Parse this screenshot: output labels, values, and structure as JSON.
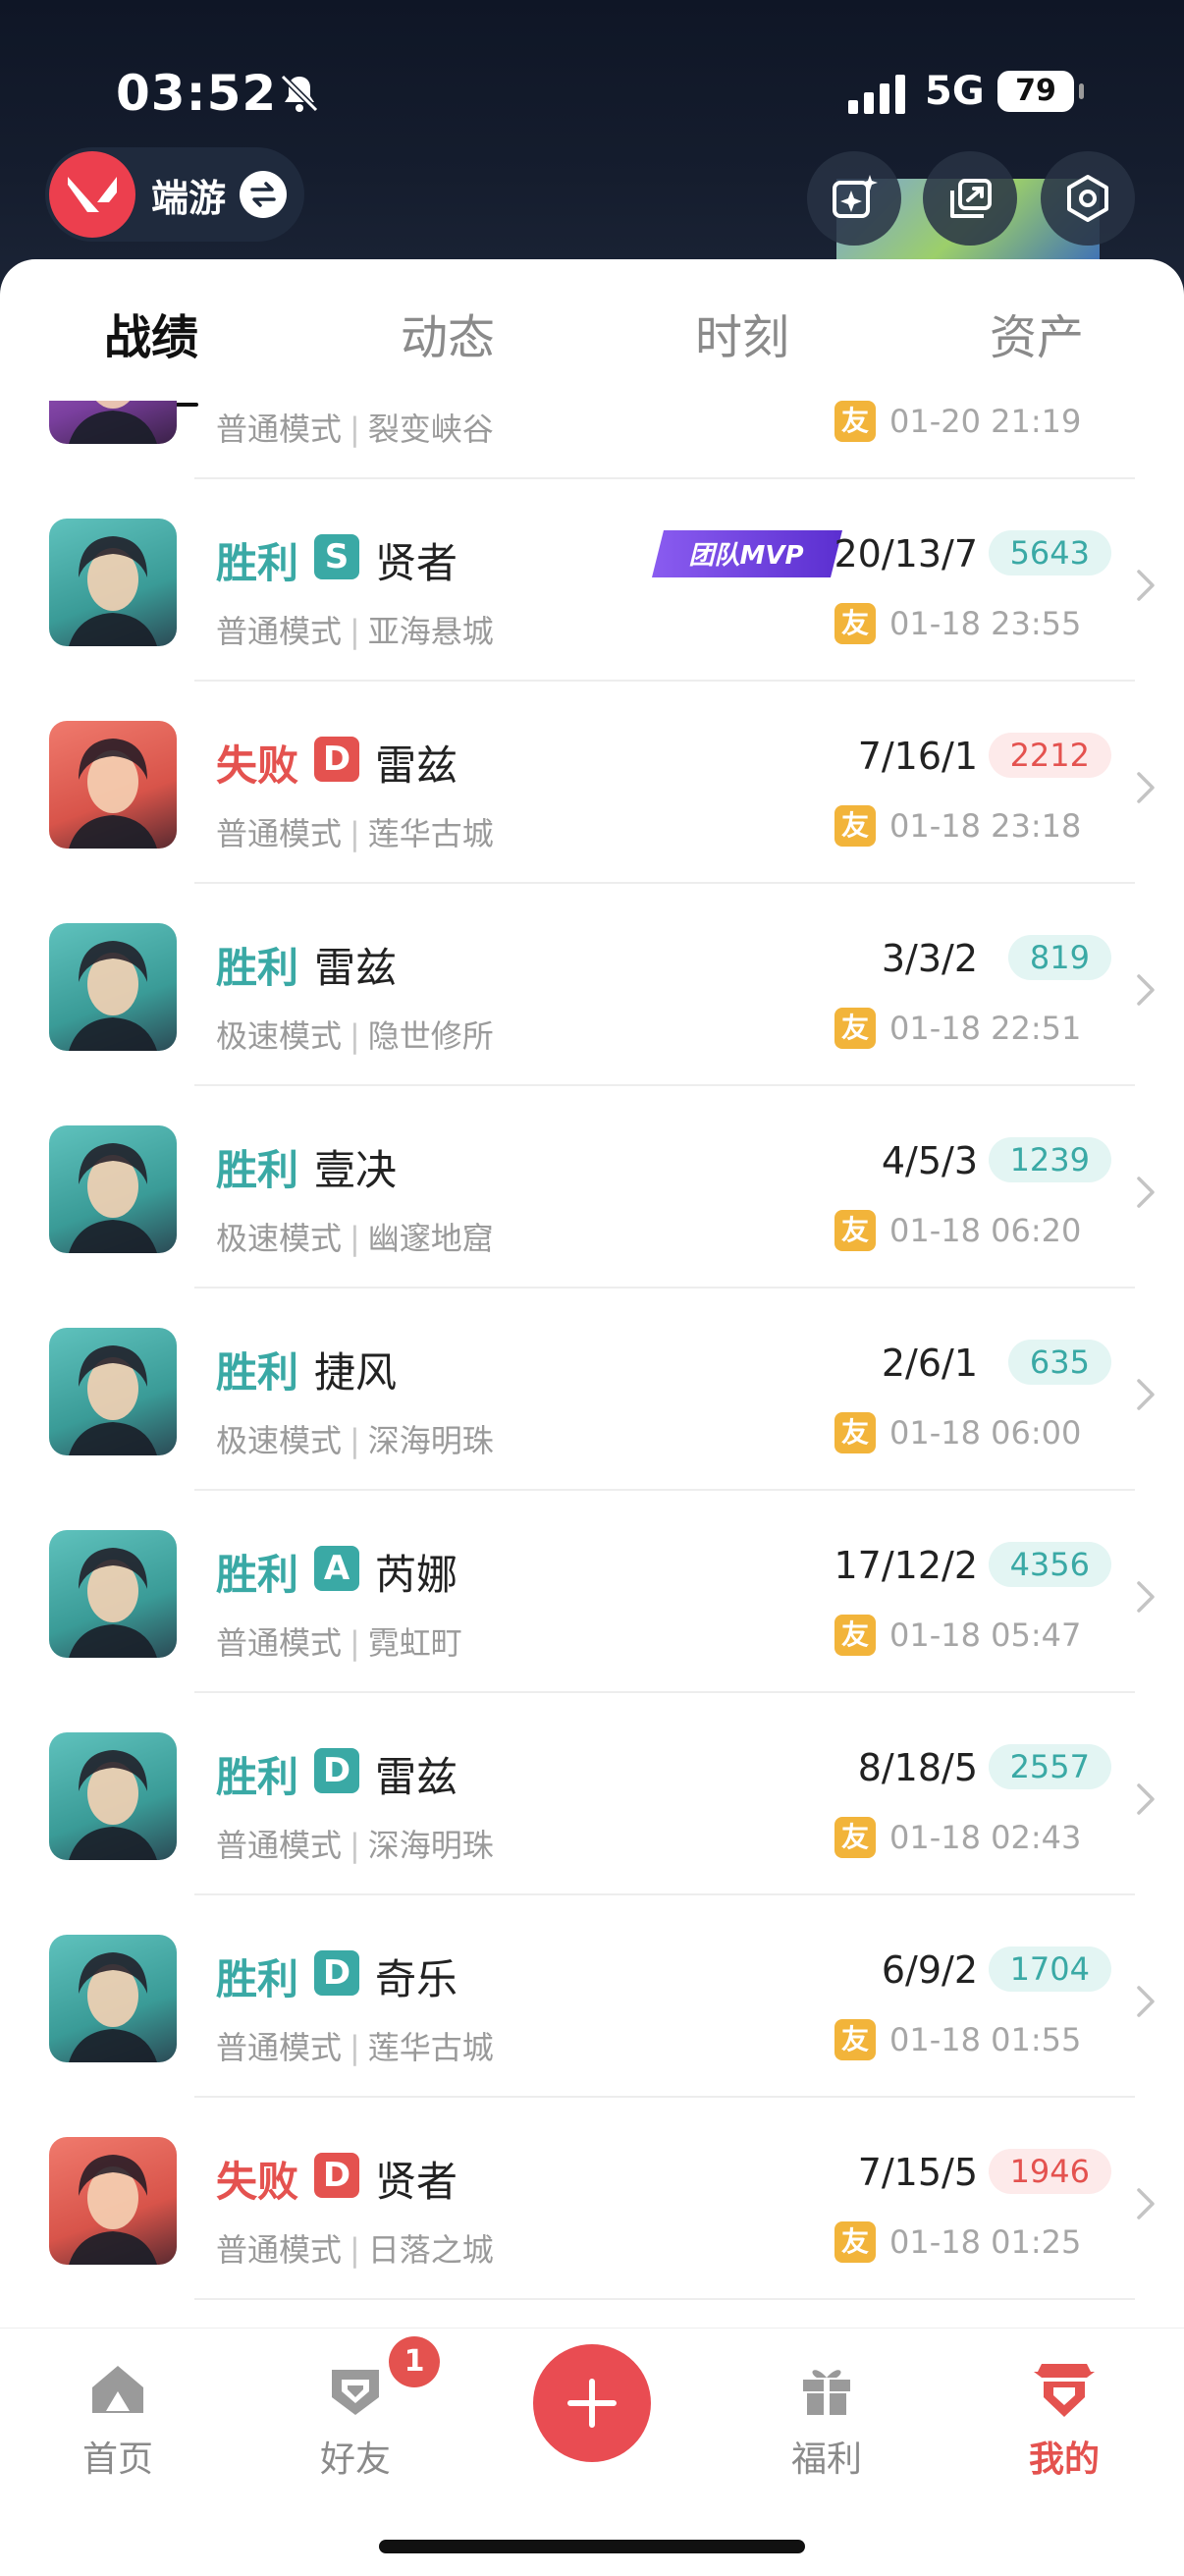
{
  "status_bar": {
    "time": "03:52",
    "network": "5G",
    "battery": "79"
  },
  "header": {
    "app_label": "端游"
  },
  "tabs": [
    {
      "label": "战绩",
      "active": true
    },
    {
      "label": "动态",
      "active": false
    },
    {
      "label": "时刻",
      "active": false
    },
    {
      "label": "资产",
      "active": false
    }
  ],
  "matches": [
    {
      "result": "",
      "result_type": "",
      "grade": "",
      "agent": "",
      "kda": "",
      "score": "",
      "mode": "普通模式",
      "map": "裂变峡谷",
      "friend_tag": "友",
      "date": "01-20 21:19",
      "mvp": "",
      "portrait": "purple"
    },
    {
      "result": "胜利",
      "result_type": "win",
      "grade": "S",
      "agent": "贤者",
      "kda": "20/13/7",
      "score": "5643",
      "mode": "普通模式",
      "map": "亚海悬城",
      "friend_tag": "友",
      "date": "01-18 23:55",
      "mvp": "团队MVP",
      "portrait": "teal"
    },
    {
      "result": "失败",
      "result_type": "lose",
      "grade": "D",
      "agent": "雷兹",
      "kda": "7/16/1",
      "score": "2212",
      "mode": "普通模式",
      "map": "莲华古城",
      "friend_tag": "友",
      "date": "01-18 23:18",
      "mvp": "",
      "portrait": "red"
    },
    {
      "result": "胜利",
      "result_type": "win",
      "grade": "",
      "agent": "雷兹",
      "kda": "3/3/2",
      "score": "819",
      "mode": "极速模式",
      "map": "隐世修所",
      "friend_tag": "友",
      "date": "01-18 22:51",
      "mvp": "",
      "portrait": "teal"
    },
    {
      "result": "胜利",
      "result_type": "win",
      "grade": "",
      "agent": "壹决",
      "kda": "4/5/3",
      "score": "1239",
      "mode": "极速模式",
      "map": "幽邃地窟",
      "friend_tag": "友",
      "date": "01-18 06:20",
      "mvp": "",
      "portrait": "teal"
    },
    {
      "result": "胜利",
      "result_type": "win",
      "grade": "",
      "agent": "捷风",
      "kda": "2/6/1",
      "score": "635",
      "mode": "极速模式",
      "map": "深海明珠",
      "friend_tag": "友",
      "date": "01-18 06:00",
      "mvp": "",
      "portrait": "teal"
    },
    {
      "result": "胜利",
      "result_type": "win",
      "grade": "A",
      "agent": "芮娜",
      "kda": "17/12/2",
      "score": "4356",
      "mode": "普通模式",
      "map": "霓虹町",
      "friend_tag": "友",
      "date": "01-18 05:47",
      "mvp": "",
      "portrait": "teal"
    },
    {
      "result": "胜利",
      "result_type": "win",
      "grade": "D",
      "agent": "雷兹",
      "kda": "8/18/5",
      "score": "2557",
      "mode": "普通模式",
      "map": "深海明珠",
      "friend_tag": "友",
      "date": "01-18 02:43",
      "mvp": "",
      "portrait": "teal"
    },
    {
      "result": "胜利",
      "result_type": "win",
      "grade": "D",
      "agent": "奇乐",
      "kda": "6/9/2",
      "score": "1704",
      "mode": "普通模式",
      "map": "莲华古城",
      "friend_tag": "友",
      "date": "01-18 01:55",
      "mvp": "",
      "portrait": "teal"
    },
    {
      "result": "失败",
      "result_type": "lose",
      "grade": "D",
      "agent": "贤者",
      "kda": "7/15/5",
      "score": "1946",
      "mode": "普通模式",
      "map": "日落之城",
      "friend_tag": "友",
      "date": "01-18 01:25",
      "mvp": "",
      "portrait": "red"
    }
  ],
  "bottom_nav": {
    "items": [
      {
        "label": "首页",
        "icon": "home-icon",
        "active": false
      },
      {
        "label": "好友",
        "icon": "friends-icon",
        "active": false,
        "badge": "1"
      },
      {
        "label": "",
        "icon": "plus-icon",
        "active": false
      },
      {
        "label": "福利",
        "icon": "gift-icon",
        "active": false
      },
      {
        "label": "我的",
        "icon": "profile-icon",
        "active": true
      }
    ]
  },
  "colors": {
    "win": "#3aa9a5",
    "lose": "#e4524f",
    "friend": "#f2b43a",
    "accent": "#e94c52"
  }
}
